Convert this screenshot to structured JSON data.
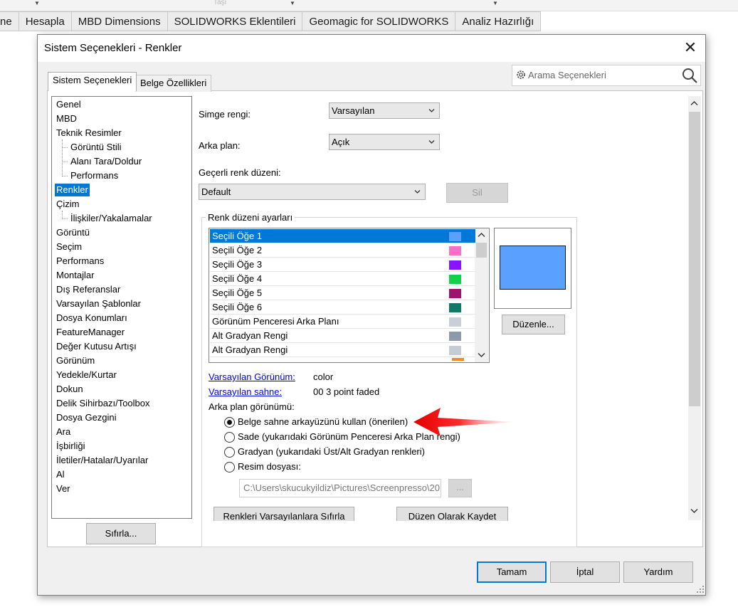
{
  "ribbon": {
    "tabs": [
      "ne",
      "Hesapla",
      "MBD Dimensions",
      "SOLIDWORKS Eklentileri",
      "Geomagic for SOLIDWORKS",
      "Analiz Hazırlığı"
    ],
    "faint_text": "Taşı"
  },
  "dialog": {
    "title": "Sistem Seçenekleri - Renkler",
    "tabs": {
      "system": "Sistem Seçenekleri",
      "document": "Belge Özellikleri"
    },
    "search_placeholder": "Arama Seçenekleri",
    "tree": [
      {
        "label": "Genel",
        "indent": 0
      },
      {
        "label": "MBD",
        "indent": 0
      },
      {
        "label": "Teknik Resimler",
        "indent": 0
      },
      {
        "label": "Görüntü Stili",
        "indent": 1
      },
      {
        "label": "Alanı Tara/Doldur",
        "indent": 1
      },
      {
        "label": "Performans",
        "indent": 1
      },
      {
        "label": "Renkler",
        "indent": 0,
        "selected": true
      },
      {
        "label": "Çizim",
        "indent": 0
      },
      {
        "label": "İlişkiler/Yakalamalar",
        "indent": 1
      },
      {
        "label": "Görüntü",
        "indent": 0
      },
      {
        "label": "Seçim",
        "indent": 0
      },
      {
        "label": "Performans",
        "indent": 0
      },
      {
        "label": "Montajlar",
        "indent": 0
      },
      {
        "label": "Dış Referanslar",
        "indent": 0
      },
      {
        "label": "Varsayılan Şablonlar",
        "indent": 0
      },
      {
        "label": "Dosya Konumları",
        "indent": 0
      },
      {
        "label": "FeatureManager",
        "indent": 0
      },
      {
        "label": "Değer Kutusu Artışı",
        "indent": 0
      },
      {
        "label": "Görünüm",
        "indent": 0
      },
      {
        "label": "Yedekle/Kurtar",
        "indent": 0
      },
      {
        "label": "Dokun",
        "indent": 0
      },
      {
        "label": "Delik Sihirbazı/Toolbox",
        "indent": 0
      },
      {
        "label": "Dosya Gezgini",
        "indent": 0
      },
      {
        "label": "Ara",
        "indent": 0
      },
      {
        "label": "İşbirliği",
        "indent": 0
      },
      {
        "label": "İletiler/Hatalar/Uyarılar",
        "indent": 0
      },
      {
        "label": "Al",
        "indent": 0
      },
      {
        "label": "Ver",
        "indent": 0
      }
    ],
    "reset_button": "Sıfırla...",
    "icon_color_label": "Simge rengi:",
    "icon_color_value": "Varsayılan",
    "background_label": "Arka plan:",
    "background_value": "Açık",
    "scheme_label": "Geçerli renk düzeni:",
    "scheme_value": "Default",
    "delete_button": "Sil",
    "group_title": "Renk düzeni ayarları",
    "color_items": [
      {
        "label": "Seçili Öğe 1",
        "color": "#5aa0ff",
        "selected": true
      },
      {
        "label": "Seçili Öğe 2",
        "color": "#ff6fc8"
      },
      {
        "label": "Seçili Öğe 3",
        "color": "#8a14ff"
      },
      {
        "label": "Seçili Öğe 4",
        "color": "#12d04a"
      },
      {
        "label": "Seçili Öğe 5",
        "color": "#a0106e"
      },
      {
        "label": "Seçili Öğe 6",
        "color": "#0f7a66"
      },
      {
        "label": "Görünüm Penceresi Arka Planı",
        "color": "#c9cfd8"
      },
      {
        "label": "Alt Gradyan Rengi",
        "color": "#8e9aab"
      },
      {
        "label": "Alt Gradyan Rengi",
        "color": "#c6ccd6"
      }
    ],
    "edit_button": "Düzenle...",
    "default_appearance_link": "Varsayılan Görünüm:",
    "default_appearance_value": "color",
    "default_scene_link": "Varsayılan sahne:",
    "default_scene_value": "00 3 point faded",
    "bg_appearance_label": "Arka plan görünümü:",
    "radios": [
      {
        "label": "Belge sahne arkayüzünü kullan (önerilen)",
        "checked": true
      },
      {
        "label": "Sade (yukarıdaki Görünüm Penceresi Arka Plan rengi)",
        "checked": false
      },
      {
        "label": "Gradyan (yukarıdaki Üst/Alt Gradyan renkleri)",
        "checked": false
      },
      {
        "label": "Resim dosyası:",
        "checked": false
      }
    ],
    "image_path": "C:\\Users\\skucukyildiz\\Pictures\\Screenpresso\\20",
    "browse_button": "...",
    "reset_colors_button": "Renkleri Varsayılanlara Sıfırla",
    "save_scheme_button": "Düzen Olarak Kaydet",
    "ok_button": "Tamam",
    "cancel_button": "İptal",
    "help_button": "Yardım"
  }
}
